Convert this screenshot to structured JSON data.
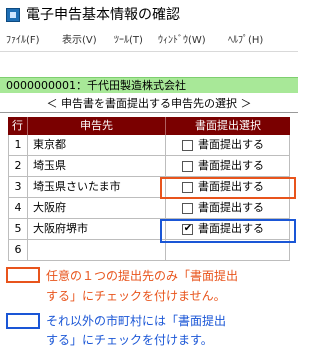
{
  "window": {
    "title": "電子申告基本情報の確認"
  },
  "menu": [
    {
      "label": "ﾌｧｲﾙ(F)"
    },
    {
      "label": "表示(V)"
    },
    {
      "label": "ﾂｰﾙ(T)"
    },
    {
      "label": "ｳｨﾝﾄﾞｳ(W)"
    },
    {
      "label": "ﾍﾙﾌﾟ(H)"
    }
  ],
  "company": {
    "text": "0000000001：千代田製造株式会社"
  },
  "subheader": {
    "text": "＜ 申告書を書面提出する申告先の選択 ＞"
  },
  "table": {
    "headers": {
      "row": "行",
      "destination": "申告先",
      "paper_select": "書面提出選択"
    },
    "rows": [
      {
        "num": "1",
        "name": "東京都",
        "checkbox": true,
        "checked": false,
        "label": "書面提出する"
      },
      {
        "num": "2",
        "name": "埼玉県",
        "checkbox": true,
        "checked": false,
        "label": "書面提出する"
      },
      {
        "num": "3",
        "name": "埼玉県さいたま市",
        "checkbox": true,
        "checked": false,
        "label": "書面提出する"
      },
      {
        "num": "4",
        "name": "大阪府",
        "checkbox": true,
        "checked": false,
        "label": "書面提出する"
      },
      {
        "num": "5",
        "name": "大阪府堺市",
        "checkbox": true,
        "checked": true,
        "label": "書面提出する"
      },
      {
        "num": "6",
        "name": "",
        "checkbox": false,
        "checked": false,
        "label": ""
      }
    ]
  },
  "legend": {
    "orange": {
      "line1": "任意の１つの提出先のみ「書面提出",
      "line2": "する」にチェックを付けません。",
      "color": "#e8541c"
    },
    "blue": {
      "line1": "それ以外の市町村には「書面提出",
      "line2": "する」にチェックを付けます。",
      "color": "#1a56d6"
    }
  },
  "checkmark": "✔"
}
